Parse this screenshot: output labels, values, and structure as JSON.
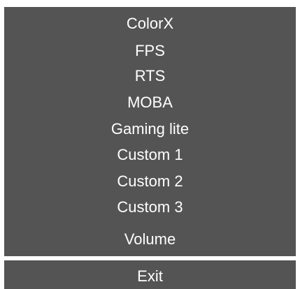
{
  "menu": {
    "items": [
      {
        "label": "ColorX"
      },
      {
        "label": "FPS"
      },
      {
        "label": "RTS"
      },
      {
        "label": "MOBA"
      },
      {
        "label": "Gaming lite"
      },
      {
        "label": "Custom 1"
      },
      {
        "label": "Custom 2"
      },
      {
        "label": "Custom 3"
      },
      {
        "label": "Volume"
      }
    ]
  },
  "exit": {
    "label": "Exit"
  },
  "colors": {
    "panel_bg": "#545454",
    "text": "#ffffff",
    "page_bg": "#ffffff"
  }
}
